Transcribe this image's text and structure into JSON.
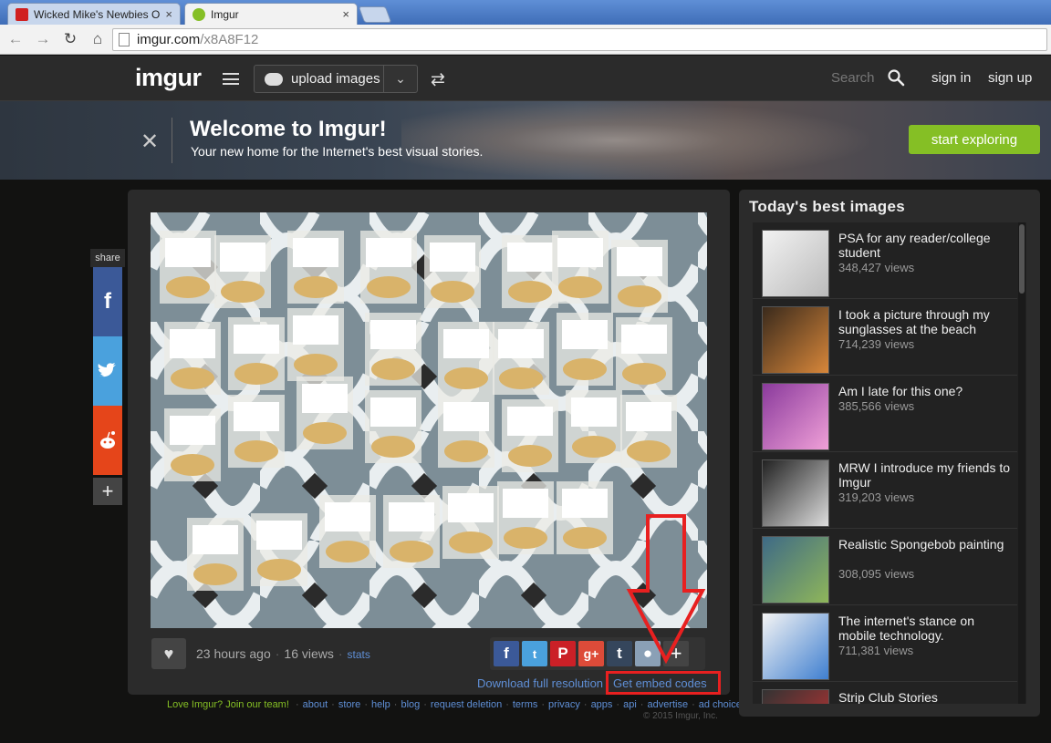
{
  "browser": {
    "tabs": [
      {
        "title": "Wicked Mike's Newbies O",
        "close": "×"
      },
      {
        "title": "Imgur",
        "close": "×"
      }
    ],
    "url_host": "imgur.com",
    "url_path": "/x8A8F12"
  },
  "header": {
    "logo": "imgur",
    "upload_label": "upload images",
    "search_label": "Search",
    "sign_in": "sign in",
    "sign_up": "sign up"
  },
  "banner": {
    "title": "Welcome to Imgur!",
    "subtitle": "Your new home for the Internet's best visual stories.",
    "cta": "start exploring"
  },
  "share": {
    "label": "share"
  },
  "post": {
    "time": "23 hours ago",
    "views": "16 views",
    "stats": "stats",
    "download": "Download full resolution",
    "embed": "Get embed codes"
  },
  "footer": {
    "join": "Love Imgur? Join our team!",
    "links": [
      "about",
      "store",
      "help",
      "blog",
      "request deletion",
      "terms",
      "privacy",
      "apps",
      "api",
      "advertise",
      "ad choices"
    ],
    "copyright": "© 2015 Imgur, Inc."
  },
  "sidebar": {
    "title": "Today's best images",
    "items": [
      {
        "title": "PSA for any reader/college student",
        "views": "348,427 views"
      },
      {
        "title": "I took a picture through my sunglasses at the beach",
        "views": "714,239 views"
      },
      {
        "title": "Am I late for this one?",
        "views": "385,566 views"
      },
      {
        "title": "MRW I introduce my friends to Imgur",
        "views": "319,203 views"
      },
      {
        "title": "Realistic Spongebob painting",
        "views": "308,095 views"
      },
      {
        "title": "The internet's stance on mobile technology.",
        "views": "711,381 views"
      },
      {
        "title": "Strip Club Stories",
        "views": ""
      }
    ]
  },
  "colors": {
    "accent_green": "#85bf25",
    "link_blue": "#5f8fd6",
    "annotation_red": "#e82020"
  }
}
